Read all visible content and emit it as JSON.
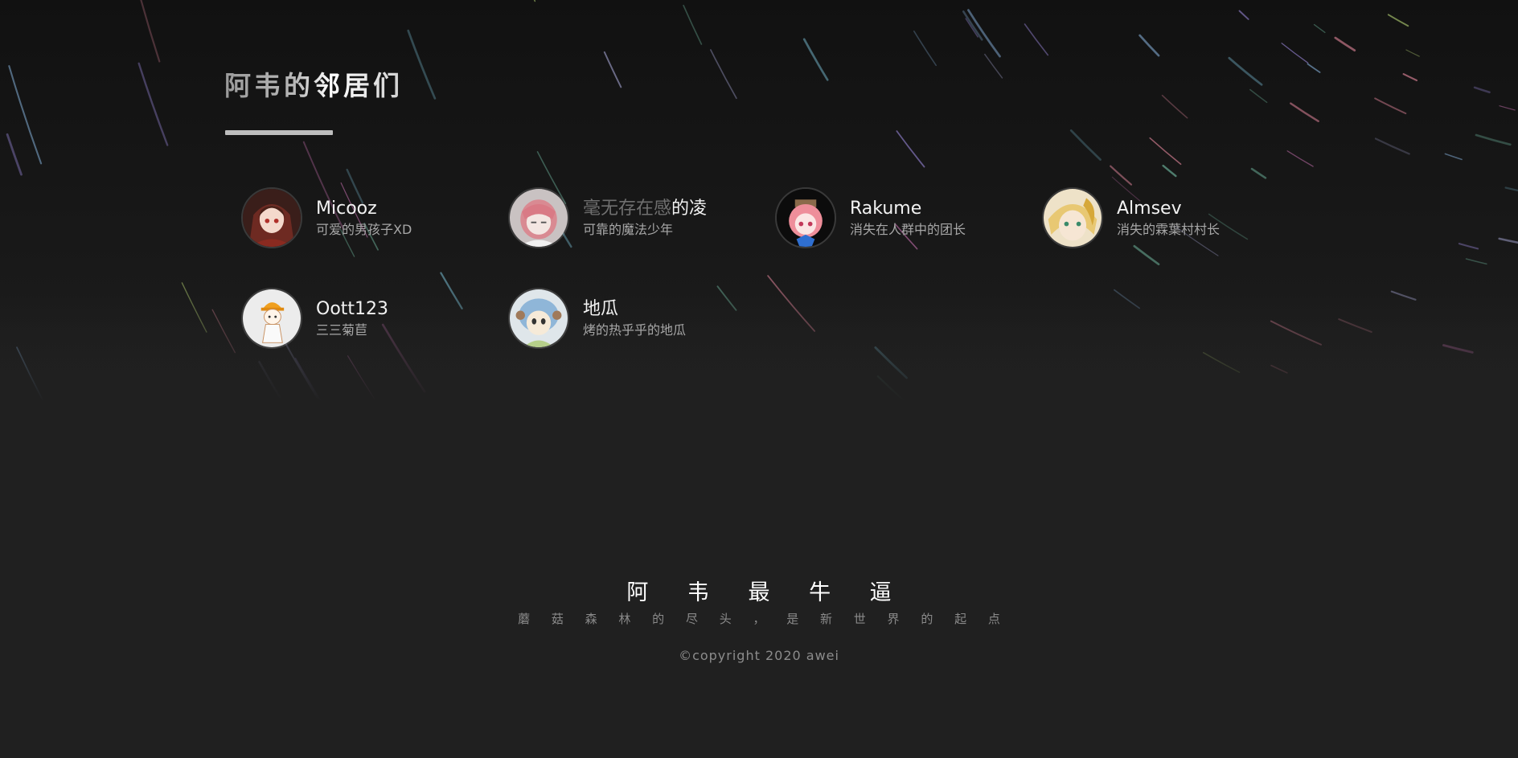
{
  "section": {
    "title": "阿韦的邻居们"
  },
  "friends": [
    {
      "name": "Micooz",
      "name_faded": "",
      "desc": "可爱的男孩子XD",
      "avatar_color": "#7a3528"
    },
    {
      "name": "的凌",
      "name_faded": "毫无存在感",
      "desc": "可靠的魔法少年",
      "avatar_color": "#c98a8e"
    },
    {
      "name": "Rakume",
      "name_faded": "",
      "desc": "消失在人群中的团长",
      "avatar_color": "#e88b95"
    },
    {
      "name": "Almsev",
      "name_faded": "",
      "desc": "消失的霖葉村村长",
      "avatar_color": "#e9d49a"
    },
    {
      "name": "Oott123",
      "name_faded": "",
      "desc": "三三菊苣",
      "avatar_color": "#e8e8e8"
    },
    {
      "name": "地瓜",
      "name_faded": "",
      "desc": "烤的热乎乎的地瓜",
      "avatar_color": "#8fb6d8"
    }
  ],
  "footer": {
    "title": "阿 韦 最 牛 逼",
    "subtitle": "蘑 菇 森 林 的 尽 头 ， 是 新 世 界 的 起 点",
    "copyright": "©copyright 2020 awei"
  },
  "colors": {
    "background": "#202020",
    "text_primary": "#f2f2f2",
    "text_secondary": "#a7a7a7"
  }
}
